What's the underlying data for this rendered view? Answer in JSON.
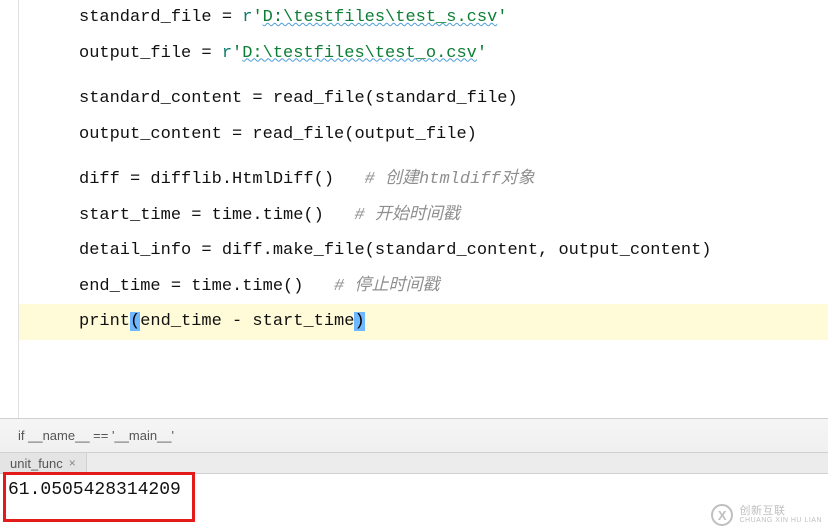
{
  "code": {
    "l1a": "standard_file = ",
    "l1r": "r",
    "l1s1": "'",
    "l1p": "D:\\testfiles\\test_s.csv",
    "l1s2": "'",
    "l2a": "output_file = ",
    "l2r": "r",
    "l2s1": "'",
    "l2p": "D:\\testfiles\\test_o.csv",
    "l2s2": "'",
    "l3": "",
    "l4": "standard_content = read_file(standard_file)",
    "l5": "output_content = read_file(output_file)",
    "l6": "",
    "l7a": "diff = difflib.HtmlDiff()   ",
    "l7c": "# 创建htmldiff对象",
    "l8a": "start_time = time.time()   ",
    "l8c": "# 开始时间戳",
    "l9": "detail_info = diff.make_file(standard_content, output_content)",
    "l10a": "end_time = time.time()   ",
    "l10c": "# 停止时间戳",
    "l11a": "print",
    "l11b": "(",
    "l11c": "end_time - start_time",
    "l11d": ")"
  },
  "breadcrumb": {
    "text": "if __name__ == '__main__'"
  },
  "tabs": {
    "t1": "unit_func"
  },
  "output": {
    "value": "61.0505428314209"
  },
  "watermark": {
    "logo": "X",
    "line1": "创新互联",
    "line2": "CHUANG XIN HU LIAN"
  }
}
